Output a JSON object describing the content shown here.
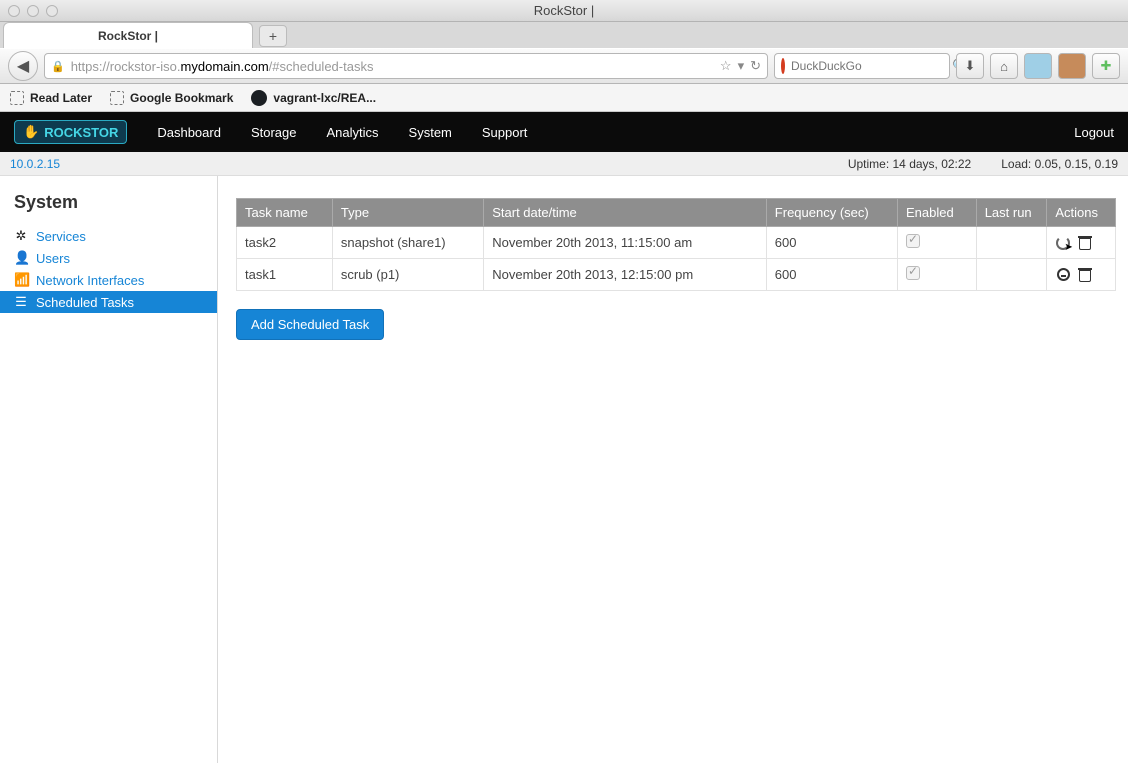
{
  "window": {
    "title": "RockStor |"
  },
  "browser": {
    "tab_title": "RockStor |",
    "url_scheme": "https://",
    "url_sub": "rockstor-iso.",
    "url_host": "mydomain.com",
    "url_path": "/#scheduled-tasks",
    "search_placeholder": "DuckDuckGo",
    "bookmarks": [
      {
        "label": "Read Later"
      },
      {
        "label": "Google Bookmark"
      },
      {
        "label": "vagrant-lxc/REA..."
      }
    ]
  },
  "navbar": {
    "brand": "ROCKSTOR",
    "links": [
      "Dashboard",
      "Storage",
      "Analytics",
      "System",
      "Support"
    ],
    "logout": "Logout"
  },
  "status": {
    "ip": "10.0.2.15",
    "uptime": "Uptime: 14 days, 02:22",
    "load": "Load: 0.05, 0.15, 0.19"
  },
  "sidebar": {
    "heading": "System",
    "items": [
      {
        "label": "Services"
      },
      {
        "label": "Users"
      },
      {
        "label": "Network Interfaces"
      },
      {
        "label": "Scheduled Tasks"
      }
    ]
  },
  "tasks": {
    "headers": [
      "Task name",
      "Type",
      "Start date/time",
      "Frequency (sec)",
      "Enabled",
      "Last run",
      "Actions"
    ],
    "rows": [
      {
        "name": "task2",
        "type": "snapshot (share1)",
        "start": "November 20th 2013, 11:15:00 am",
        "freq": "600",
        "enabled": true,
        "last_run": ""
      },
      {
        "name": "task1",
        "type": "scrub (p1)",
        "start": "November 20th 2013, 12:15:00 pm",
        "freq": "600",
        "enabled": true,
        "last_run": ""
      }
    ],
    "add_label": "Add Scheduled Task"
  }
}
